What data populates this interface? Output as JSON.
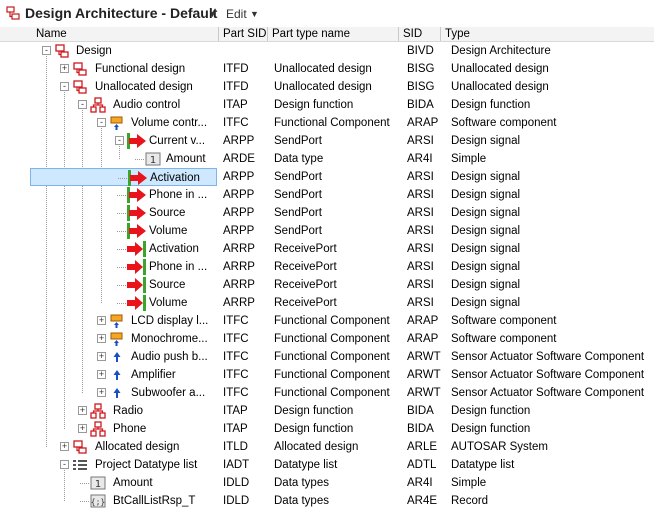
{
  "window": {
    "title": "Design Architecture - Default",
    "edit_label": "Edit"
  },
  "columns": {
    "name": "Name",
    "part_sid": "Part SID",
    "part_type_name": "Part type name",
    "sid": "SID",
    "type": "Type"
  },
  "colors": {
    "selection_bg": "#cde8ff",
    "selection_border": "#7eb4ea",
    "sendport_arrow": "#e8131b",
    "port_bar": "#3aa52a",
    "design_icon": "#d0181e"
  },
  "rows": [
    {
      "name": "Design",
      "part_sid": "",
      "part_type": "",
      "sid": "BIVD",
      "type": "Design Architecture",
      "icon": "design-icon"
    },
    {
      "name": "Functional design",
      "part_sid": "ITFD",
      "part_type": "Unallocated design",
      "sid": "BISG",
      "type": "Unallocated design",
      "icon": "unallocated-design-icon"
    },
    {
      "name": "Unallocated design",
      "part_sid": "ITFD",
      "part_type": "Unallocated design",
      "sid": "BISG",
      "type": "Unallocated design",
      "icon": "unallocated-design-icon"
    },
    {
      "name": "Audio control",
      "part_sid": "ITAP",
      "part_type": "Design function",
      "sid": "BIDA",
      "type": "Design function",
      "icon": "design-function-icon"
    },
    {
      "name": "Volume contr...",
      "part_sid": "ITFC",
      "part_type": "Functional Component",
      "sid": "ARAP",
      "type": "Software component",
      "icon": "software-component-icon"
    },
    {
      "name": "Current v...",
      "part_sid": "ARPP",
      "part_type": "SendPort",
      "sid": "ARSI",
      "type": "Design signal",
      "icon": "send-port-icon"
    },
    {
      "name": "Amount",
      "part_sid": "ARDE",
      "part_type": "Data type",
      "sid": "AR4I",
      "type": "Simple",
      "icon": "simple-datatype-icon"
    },
    {
      "name": "Activation",
      "part_sid": "ARPP",
      "part_type": "SendPort",
      "sid": "ARSI",
      "type": "Design signal",
      "icon": "send-port-icon"
    },
    {
      "name": "Phone in ...",
      "part_sid": "ARPP",
      "part_type": "SendPort",
      "sid": "ARSI",
      "type": "Design signal",
      "icon": "send-port-icon"
    },
    {
      "name": "Source",
      "part_sid": "ARPP",
      "part_type": "SendPort",
      "sid": "ARSI",
      "type": "Design signal",
      "icon": "send-port-icon"
    },
    {
      "name": "Volume",
      "part_sid": "ARPP",
      "part_type": "SendPort",
      "sid": "ARSI",
      "type": "Design signal",
      "icon": "send-port-icon"
    },
    {
      "name": "Activation",
      "part_sid": "ARRP",
      "part_type": "ReceivePort",
      "sid": "ARSI",
      "type": "Design signal",
      "icon": "receive-port-icon"
    },
    {
      "name": "Phone in ...",
      "part_sid": "ARRP",
      "part_type": "ReceivePort",
      "sid": "ARSI",
      "type": "Design signal",
      "icon": "receive-port-icon"
    },
    {
      "name": "Source",
      "part_sid": "ARRP",
      "part_type": "ReceivePort",
      "sid": "ARSI",
      "type": "Design signal",
      "icon": "receive-port-icon"
    },
    {
      "name": "Volume",
      "part_sid": "ARRP",
      "part_type": "ReceivePort",
      "sid": "ARSI",
      "type": "Design signal",
      "icon": "receive-port-icon"
    },
    {
      "name": "LCD display l...",
      "part_sid": "ITFC",
      "part_type": "Functional Component",
      "sid": "ARAP",
      "type": "Software component",
      "icon": "software-component-icon"
    },
    {
      "name": "Monochrome...",
      "part_sid": "ITFC",
      "part_type": "Functional Component",
      "sid": "ARAP",
      "type": "Software component",
      "icon": "software-component-icon"
    },
    {
      "name": "Audio push b...",
      "part_sid": "ITFC",
      "part_type": "Functional Component",
      "sid": "ARWT",
      "type": "Sensor Actuator Software Component",
      "icon": "sensor-actuator-icon"
    },
    {
      "name": "Amplifier",
      "part_sid": "ITFC",
      "part_type": "Functional Component",
      "sid": "ARWT",
      "type": "Sensor Actuator Software Component",
      "icon": "sensor-actuator-icon"
    },
    {
      "name": "Subwoofer a...",
      "part_sid": "ITFC",
      "part_type": "Functional Component",
      "sid": "ARWT",
      "type": "Sensor Actuator Software Component",
      "icon": "sensor-actuator-icon"
    },
    {
      "name": "Radio",
      "part_sid": "ITAP",
      "part_type": "Design function",
      "sid": "BIDA",
      "type": "Design function",
      "icon": "design-function-icon"
    },
    {
      "name": "Phone",
      "part_sid": "ITAP",
      "part_type": "Design function",
      "sid": "BIDA",
      "type": "Design function",
      "icon": "design-function-icon"
    },
    {
      "name": "Allocated design",
      "part_sid": "ITLD",
      "part_type": "Allocated design",
      "sid": "ARLE",
      "type": "AUTOSAR System",
      "icon": "allocated-design-icon"
    },
    {
      "name": "Project Datatype list",
      "part_sid": "IADT",
      "part_type": "Datatype list",
      "sid": "ADTL",
      "type": "Datatype list",
      "icon": "datatype-list-icon"
    },
    {
      "name": "Amount",
      "part_sid": "IDLD",
      "part_type": "Data types",
      "sid": "AR4I",
      "type": "Simple",
      "icon": "simple-datatype-icon"
    },
    {
      "name": "BtCallListRsp_T",
      "part_sid": "IDLD",
      "part_type": "Data types",
      "sid": "AR4E",
      "type": "Record",
      "icon": "record-datatype-icon"
    }
  ]
}
